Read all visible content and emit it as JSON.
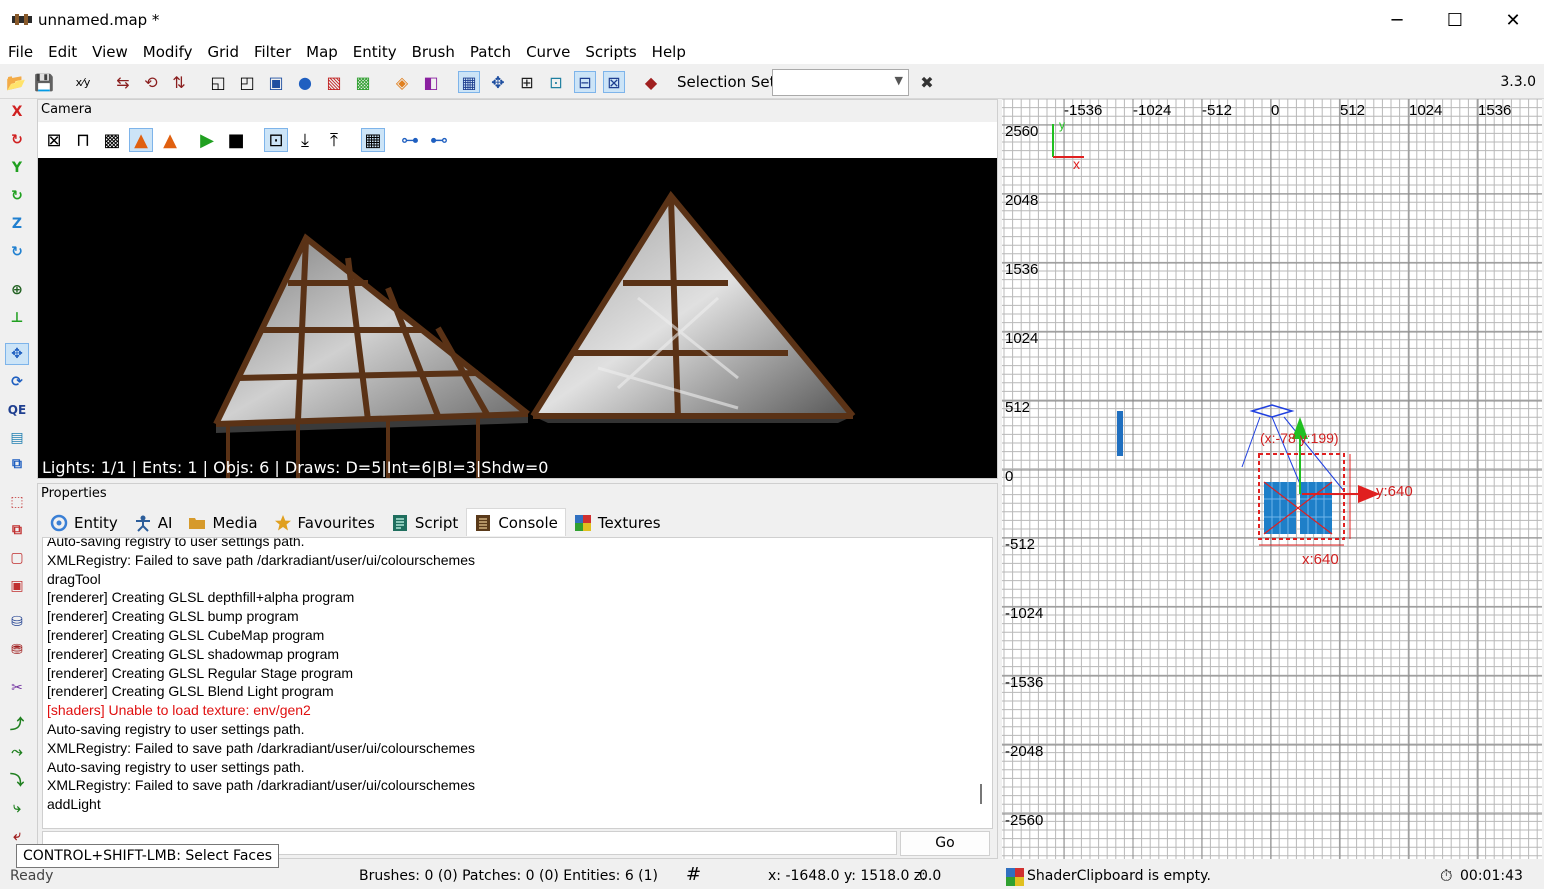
{
  "window": {
    "title": "unnamed.map *",
    "minimize": "─",
    "maximize": "☐",
    "close": "✕"
  },
  "menu": [
    "File",
    "Edit",
    "View",
    "Modify",
    "Grid",
    "Filter",
    "Map",
    "Entity",
    "Brush",
    "Patch",
    "Curve",
    "Scripts",
    "Help"
  ],
  "toolbar": {
    "selection_set_label": "Selection Set:",
    "selection_set_value": "",
    "clear_icon": "✖",
    "version": "3.3.0"
  },
  "camera": {
    "title": "Camera",
    "stats": "Lights: 1/1 | Ents: 1 | Objs: 6 | Draws: D=5|Int=6|Bl=3|Shdw=0"
  },
  "properties": {
    "title": "Properties",
    "tabs": [
      {
        "label": "Entity",
        "icon": "entity-icon",
        "color": "#3a7fd5"
      },
      {
        "label": "AI",
        "icon": "ai-icon",
        "color": "#2c5d9a"
      },
      {
        "label": "Media",
        "icon": "media-folder-icon",
        "color": "#d69a2b"
      },
      {
        "label": "Favourites",
        "icon": "star-icon",
        "color": "#e0a020"
      },
      {
        "label": "Script",
        "icon": "script-icon",
        "color": "#1f6e5e"
      },
      {
        "label": "Console",
        "icon": "console-icon",
        "color": "#5a3a1a"
      },
      {
        "label": "Textures",
        "icon": "textures-icon",
        "color": "#3070c0"
      }
    ],
    "selected_tab": "Console",
    "console_lines": [
      {
        "text": "Auto-saving registry to user settings path.",
        "error": false
      },
      {
        "text": "XMLRegistry: Failed to save path /darkradiant/user/ui/colourschemes",
        "error": false
      },
      {
        "text": "dragTool",
        "error": false
      },
      {
        "text": "[renderer] Creating GLSL depthfill+alpha program",
        "error": false
      },
      {
        "text": "[renderer] Creating GLSL bump program",
        "error": false
      },
      {
        "text": "[renderer] Creating GLSL CubeMap program",
        "error": false
      },
      {
        "text": "[renderer] Creating GLSL shadowmap program",
        "error": false
      },
      {
        "text": "[renderer] Creating GLSL Regular Stage program",
        "error": false
      },
      {
        "text": "[renderer] Creating GLSL Blend Light program",
        "error": false
      },
      {
        "text": "[shaders] Unable to load texture: env/gen2",
        "error": true
      },
      {
        "text": "Auto-saving registry to user settings path.",
        "error": false
      },
      {
        "text": "XMLRegistry: Failed to save path /darkradiant/user/ui/colourschemes",
        "error": false
      },
      {
        "text": "Auto-saving registry to user settings path.",
        "error": false
      },
      {
        "text": "XMLRegistry: Failed to save path /darkradiant/user/ui/colourschemes",
        "error": false
      },
      {
        "text": "addLight",
        "error": false
      }
    ],
    "command_value": "",
    "go_label": "Go"
  },
  "ortho": {
    "top_labels": [
      "-1536",
      "-1024",
      "-512",
      "0",
      "512",
      "1024",
      "1536"
    ],
    "left_labels": [
      "2560",
      "2048",
      "1536",
      "1024",
      "512",
      "0",
      "-512",
      "-1024",
      "-1536",
      "-2048",
      "-2560"
    ],
    "axis_x": "x",
    "axis_y": "y",
    "selection_coords": "(x:-78 y:199)",
    "size_x": "x:640",
    "size_y": "y:640"
  },
  "status": {
    "tooltip": "CONTROL+SHIFT-LMB: Select Faces",
    "ready": "Ready",
    "counts": "Brushes: 0 (0) Patches: 0 (0) Entities: 6 (1)",
    "coords": "x: -1648.0 y: 1518.0 z:",
    "z_value": "0.0",
    "clipboard": "ShaderClipboard is empty.",
    "timer": "00:01:43"
  }
}
